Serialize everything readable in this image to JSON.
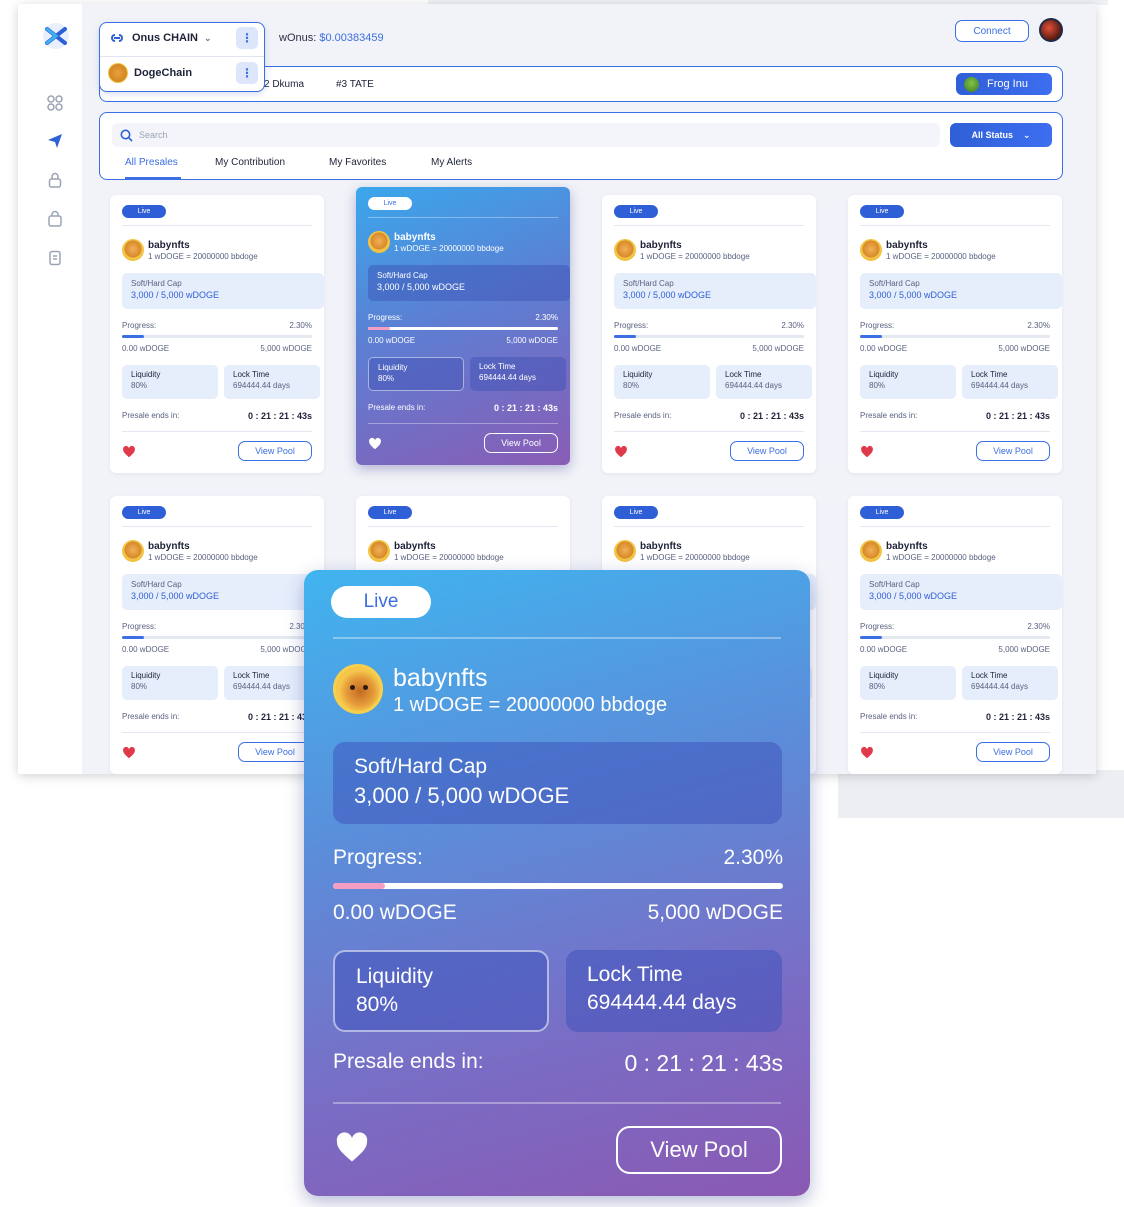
{
  "header": {
    "wonus_label": "wOnus:",
    "wonus_value": "$0.00383459",
    "connect_label": "Connect"
  },
  "chain_selector": {
    "items": [
      {
        "label": "Onus CHAIN"
      },
      {
        "label": "DogeChain"
      }
    ]
  },
  "ticker": {
    "items": [
      "2 Dkuma",
      "#3 TATE"
    ],
    "featured_label": "Frog Inu"
  },
  "filter": {
    "search_placeholder": "Search",
    "status_label": "All Status",
    "tabs": [
      "All Presales",
      "My Contribution",
      "My Favorites",
      "My Alerts"
    ]
  },
  "card": {
    "live_label": "Live",
    "name": "babynfts",
    "rate": "1 wDOGE = 20000000 bbdoge",
    "cap_label": "Soft/Hard Cap",
    "cap_value": "3,000 / 5,000 wDOGE",
    "progress_label": "Progress:",
    "progress_pct": "2.30%",
    "progress_fraction": 0.023,
    "min_label": "0.00 wDOGE",
    "max_label": "5,000 wDOGE",
    "liquidity_label": "Liquidity",
    "liquidity_value": "80%",
    "lock_label": "Lock Time",
    "lock_value": "694444.44 days",
    "ends_label": "Presale ends in:",
    "ends_value": "0 : 21 : 21 : 43s",
    "view_label": "View Pool"
  },
  "colors": {
    "accent": "#3b6fe3",
    "heart": "#e03a4a",
    "progress_fill": "#f59ec5"
  }
}
